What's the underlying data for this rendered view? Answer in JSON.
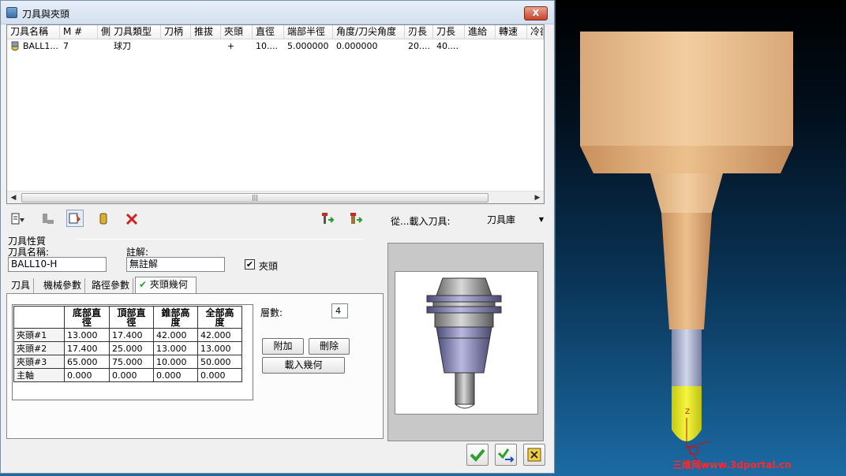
{
  "window": {
    "title": "刀具與夾頭",
    "close_symbol": "X"
  },
  "tool_list": {
    "columns": [
      "刀具名稱",
      "M #",
      "側",
      "刀具類型",
      "刀柄",
      "推拔",
      "夾頭",
      "直徑",
      "端部半徑",
      "角度/刀尖角度",
      "刃長",
      "刀長",
      "進給",
      "轉速",
      "冷卻"
    ],
    "rows": [
      [
        "BALL1...",
        "7",
        "",
        "球刀",
        "",
        "",
        "+",
        "10....",
        "5.000000",
        "0.000000",
        "20....",
        "40....",
        "",
        "",
        ""
      ]
    ],
    "scroll_grip": "|||"
  },
  "toolbar": {
    "source_label": "從...載入刀具:",
    "library_value": "刀具庫"
  },
  "properties": {
    "group_label": "刀具性質",
    "tool_name_label": "刀具名稱:",
    "tool_name_value": "BALL10-H",
    "note_label": "註解:",
    "note_value": "無註解",
    "holder_checkbox_label": "夾頭",
    "holder_checkbox_mark": "✔"
  },
  "tabs": [
    "刀具",
    "機械參數",
    "路徑參數",
    "夾頭幾何"
  ],
  "holder_table": {
    "headers": [
      "底部直徑",
      "頂部直徑",
      "錐部高度",
      "全部高度"
    ],
    "header_lines": [
      [
        "底部直",
        "徑"
      ],
      [
        "頂部直",
        "徑"
      ],
      [
        "錐部高",
        "度"
      ],
      [
        "全部高",
        "度"
      ]
    ],
    "rows": [
      {
        "name": "夾頭#1",
        "values": [
          "13.000",
          "17.400",
          "42.000",
          "42.000"
        ]
      },
      {
        "name": "夾頭#2",
        "values": [
          "17.400",
          "25.000",
          "13.000",
          "13.000"
        ]
      },
      {
        "name": "夾頭#3",
        "values": [
          "65.000",
          "75.000",
          "10.000",
          "50.000"
        ]
      },
      {
        "name": "主軸",
        "values": [
          "0.000",
          "0.000",
          "0.000",
          "0.000"
        ]
      }
    ]
  },
  "layers": {
    "label": "層數:",
    "value": "4"
  },
  "buttons": {
    "add": "附加",
    "delete": "刪除",
    "load_geometry": "載入幾何"
  },
  "viewport": {
    "watermark": "三维网www.3dportal.cn",
    "axis_label": "Z"
  },
  "colors": {
    "accent_red": "#d02020",
    "ok_green": "#2fa030",
    "holder_tan": "#e8c49a",
    "tool_yellow": "#eef028"
  }
}
